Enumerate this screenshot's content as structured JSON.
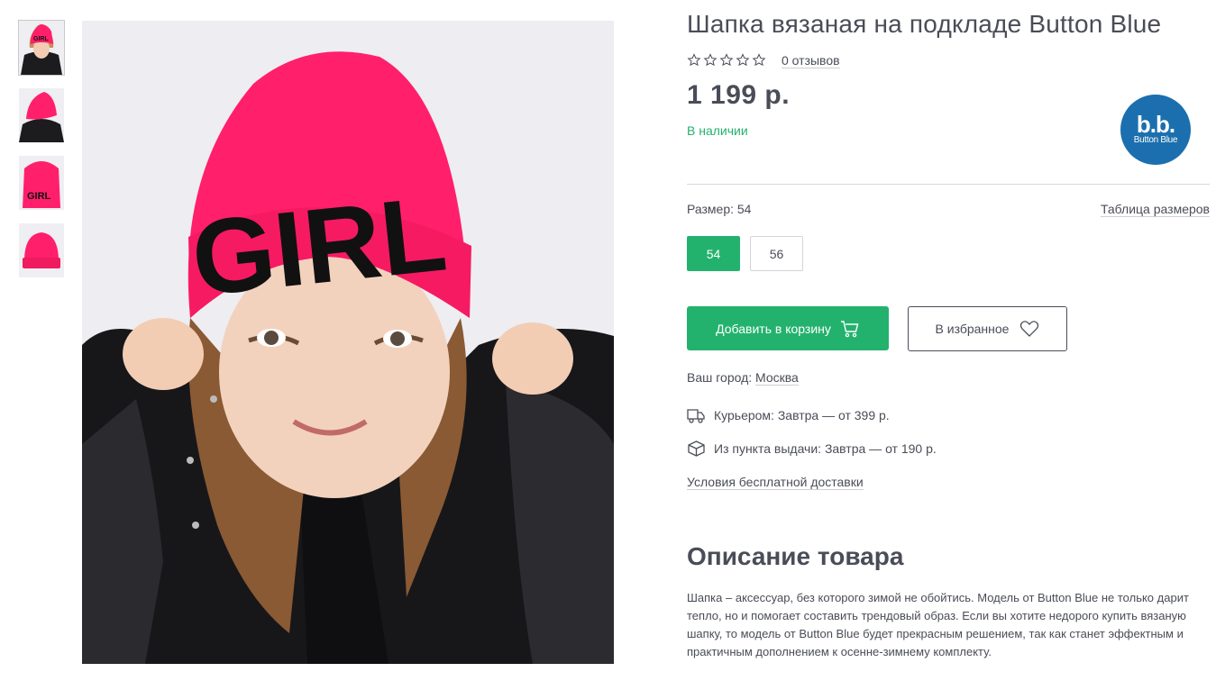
{
  "product": {
    "title": "Шапка вязаная на подкладе Button Blue",
    "reviews_label": "0 отзывов",
    "rating": 0,
    "rating_max": 5,
    "price": "1 199 р.",
    "availability": "В наличии"
  },
  "brand": {
    "logo_mark": "b.b.",
    "logo_name": "Button Blue",
    "logo_color": "#1b6fae"
  },
  "size": {
    "label": "Размер: 54",
    "table_link": "Таблица размеров",
    "options": [
      "54",
      "56"
    ],
    "selected": "54"
  },
  "actions": {
    "cart_label": "Добавить в корзину",
    "cart_icon": "cart-icon",
    "fav_label": "В избранное",
    "fav_icon": "heart-icon"
  },
  "delivery": {
    "city_prefix": "Ваш город:",
    "city": "Москва",
    "courier": "Курьером: Завтра — от 399 р.",
    "courier_icon": "truck-icon",
    "pickup": "Из пункта выдачи: Завтра — от 190 р.",
    "pickup_icon": "box-icon",
    "free_link": "Условия бесплатной доставки"
  },
  "description": {
    "title": "Описание товара",
    "text": "Шапка – аксессуар, без которого зимой не обойтись. Модель от Button Blue не только дарит тепло, но и помогает составить трендовый образ. Если вы хотите недорого купить вязаную шапку, то модель от Button Blue будет прекрасным решением, так как станет эффектным и практичным дополнением к осенне-зимнему комплекту."
  },
  "gallery": {
    "thumbnail_count": 4,
    "hat_text": "GIRL"
  },
  "colors": {
    "accent": "#23b26d",
    "text": "#4a4d57",
    "hat": "#ff1f6a"
  }
}
